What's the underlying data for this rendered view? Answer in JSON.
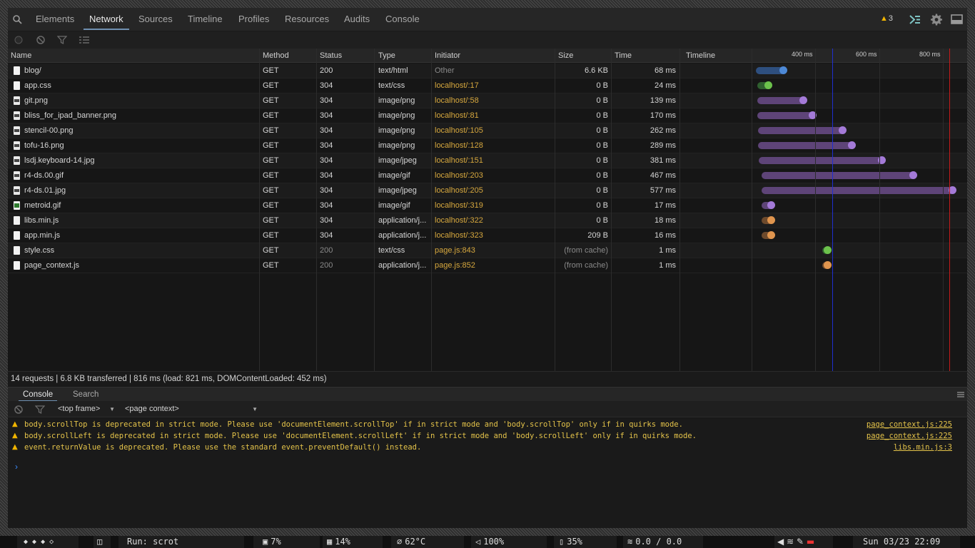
{
  "tabs": [
    "Elements",
    "Network",
    "Sources",
    "Timeline",
    "Profiles",
    "Resources",
    "Audits",
    "Console"
  ],
  "active_tab": "Network",
  "warning_count": "3",
  "columns": {
    "name": "Name",
    "method": "Method",
    "status": "Status",
    "type": "Type",
    "initiator": "Initiator",
    "size": "Size",
    "time": "Time",
    "timeline": "Timeline"
  },
  "timeline_labels": [
    "400 ms",
    "600 ms",
    "800 ms"
  ],
  "requests": [
    {
      "name": "blog/",
      "method": "GET",
      "status": "200",
      "type": "text/html",
      "initiator": "Other",
      "size": "6.6 KB",
      "time": "68 ms",
      "icon": "doc"
    },
    {
      "name": "app.css",
      "method": "GET",
      "status": "304",
      "type": "text/css",
      "initiator": "localhost/:17",
      "size": "0 B",
      "time": "24 ms",
      "icon": "doc"
    },
    {
      "name": "git.png",
      "method": "GET",
      "status": "304",
      "type": "image/png",
      "initiator": "localhost/:58",
      "size": "0 B",
      "time": "139 ms",
      "icon": "img"
    },
    {
      "name": "bliss_for_ipad_banner.png",
      "method": "GET",
      "status": "304",
      "type": "image/png",
      "initiator": "localhost/:81",
      "size": "0 B",
      "time": "170 ms",
      "icon": "img"
    },
    {
      "name": "stencil-00.png",
      "method": "GET",
      "status": "304",
      "type": "image/png",
      "initiator": "localhost/:105",
      "size": "0 B",
      "time": "262 ms",
      "icon": "img"
    },
    {
      "name": "tofu-16.png",
      "method": "GET",
      "status": "304",
      "type": "image/png",
      "initiator": "localhost/:128",
      "size": "0 B",
      "time": "289 ms",
      "icon": "img"
    },
    {
      "name": "lsdj.keyboard-14.jpg",
      "method": "GET",
      "status": "304",
      "type": "image/jpeg",
      "initiator": "localhost/:151",
      "size": "0 B",
      "time": "381 ms",
      "icon": "img"
    },
    {
      "name": "r4-ds.00.gif",
      "method": "GET",
      "status": "304",
      "type": "image/gif",
      "initiator": "localhost/:203",
      "size": "0 B",
      "time": "467 ms",
      "icon": "img"
    },
    {
      "name": "r4-ds.01.jpg",
      "method": "GET",
      "status": "304",
      "type": "image/jpeg",
      "initiator": "localhost/:205",
      "size": "0 B",
      "time": "577 ms",
      "icon": "img"
    },
    {
      "name": "metroid.gif",
      "method": "GET",
      "status": "304",
      "type": "image/gif",
      "initiator": "localhost/:319",
      "size": "0 B",
      "time": "17 ms",
      "icon": "gif"
    },
    {
      "name": "libs.min.js",
      "method": "GET",
      "status": "304",
      "type": "application/j...",
      "initiator": "localhost/:322",
      "size": "0 B",
      "time": "18 ms",
      "icon": "doc"
    },
    {
      "name": "app.min.js",
      "method": "GET",
      "status": "304",
      "type": "application/j...",
      "initiator": "localhost/:323",
      "size": "209 B",
      "time": "16 ms",
      "icon": "doc"
    },
    {
      "name": "style.css",
      "method": "GET",
      "status": "200",
      "type": "text/css",
      "initiator": "page.js:843",
      "size": "(from cache)",
      "time": "1 ms",
      "icon": "doc"
    },
    {
      "name": "page_context.js",
      "method": "GET",
      "status": "200",
      "type": "application/j...",
      "initiator": "page.js:852",
      "size": "(from cache)",
      "time": "1 ms",
      "icon": "doc"
    }
  ],
  "summary": "14 requests  |  6.8 KB transferred  |  816 ms (load: 821 ms, DOMContentLoaded: 452 ms)",
  "drawer_tabs": [
    "Console",
    "Search"
  ],
  "frame_select": "<top frame>",
  "context_select": "<page context>",
  "console_messages": [
    {
      "text": "body.scrollTop is deprecated in strict mode. Please use 'documentElement.scrollTop' if in strict mode and 'body.scrollTop' only if in quirks mode.",
      "source": "page_context.js:225"
    },
    {
      "text": "body.scrollLeft is deprecated in strict mode. Please use 'documentElement.scrollLeft' if in strict mode and 'body.scrollLeft' only if in quirks mode.",
      "source": "page_context.js:225"
    },
    {
      "text": "event.returnValue is deprecated. Please use the standard event.preventDefault() instead.",
      "source": "libs.min.js:3"
    }
  ],
  "prompt_symbol": "›",
  "statusbar": {
    "workspaces": "◆ ◆ ◆ ◇",
    "run": "Run: scrot",
    "cpu": "7%",
    "mem": "14%",
    "temp": "62°C",
    "volume": "100%",
    "battery": "35%",
    "network": "0.0 / 0.0",
    "datetime": "Sun 03/23 22:09"
  },
  "colors": {
    "accent": "#6f8fb0",
    "warning": "#f0b400",
    "link": "#d7a83e",
    "bar_purple": "#6b4f86",
    "bar_blue": "#3e5f8f",
    "bar_green": "#3e7f3e",
    "bar_orange": "#8f6036",
    "dom_line": "#1f2fd0",
    "load_line": "#c41a1a"
  }
}
